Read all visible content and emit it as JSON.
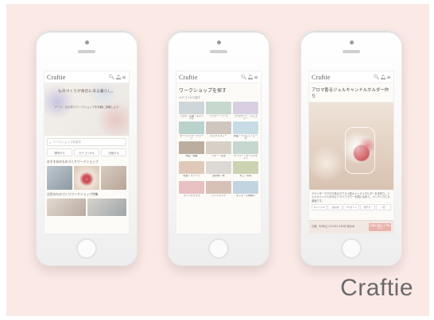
{
  "brand": {
    "name": "Craftie"
  },
  "header_icons": [
    "search-icon",
    "bell-icon",
    "menu-icon"
  ],
  "screen1": {
    "hero": {
      "title": "ものづくりが身近にある暮らし。",
      "subtitle": "アート・もの作りワークショップを気軽に体験しよう"
    },
    "search_placeholder": "ワークショップを探す",
    "chips": [
      "場所から",
      "カテゴリから",
      "日程から"
    ],
    "section1_title": "おすすめのものづくりワークショップ",
    "section2_title": "注目のものづくりワークショップ特集"
  },
  "screen2": {
    "title": "ワークショップを探す",
    "subtitle": "カテゴリから探す",
    "categories": [
      "アロマ・石鹸・キャンドル",
      "フラワー・リース",
      "アクセサリー・ジュエリー",
      "ガーデニング・グリーン",
      "カリグラフィー",
      "刺繍・フェルト・ビーズ",
      "陶芸・陶器",
      "レザー・皮革",
      "ペーパー・カードデザイン",
      "料理・スイーツ",
      "染め物・布",
      "木工・家具",
      "ステンドグラス",
      "ハンドメイド",
      "キッズ・子供向け"
    ],
    "tile_colors": [
      "#cfd6da",
      "#c7d9cf",
      "#d8d0e2",
      "#b9d2cc",
      "#cfc6c0",
      "#c8dce6",
      "#bcae9e",
      "#d6d0c6",
      "#c6d7cf",
      "#e0c9b9",
      "#dcd9d4",
      "#cbd3b2",
      "#e6c0c3",
      "#d7c1b7",
      "#c2d4e0"
    ]
  },
  "screen3": {
    "title": "アロマ香るジェルキャンドルホルダー作り",
    "description": "ラベンダーでアロマ系のマクラメ型キャンドルホルダーを手作り。ジェルキャンドルの中にドライフラワーを閉じ込めて、インテリアにも最適です。",
    "tags": [
      "キャンドル",
      "初心者",
      "プレゼント",
      "駅チカ",
      "1日"
    ],
    "date_text": "日時：9/28(土) 14:00〜16:00 受付中",
    "cta": "日程を選択して予約する"
  },
  "logo_text": "Craftie",
  "colors": {
    "backdrop": "#fbe9e6",
    "accent": "#e9b2aa",
    "text_dark": "#444444",
    "logo_gray": "#6a6a6a"
  }
}
